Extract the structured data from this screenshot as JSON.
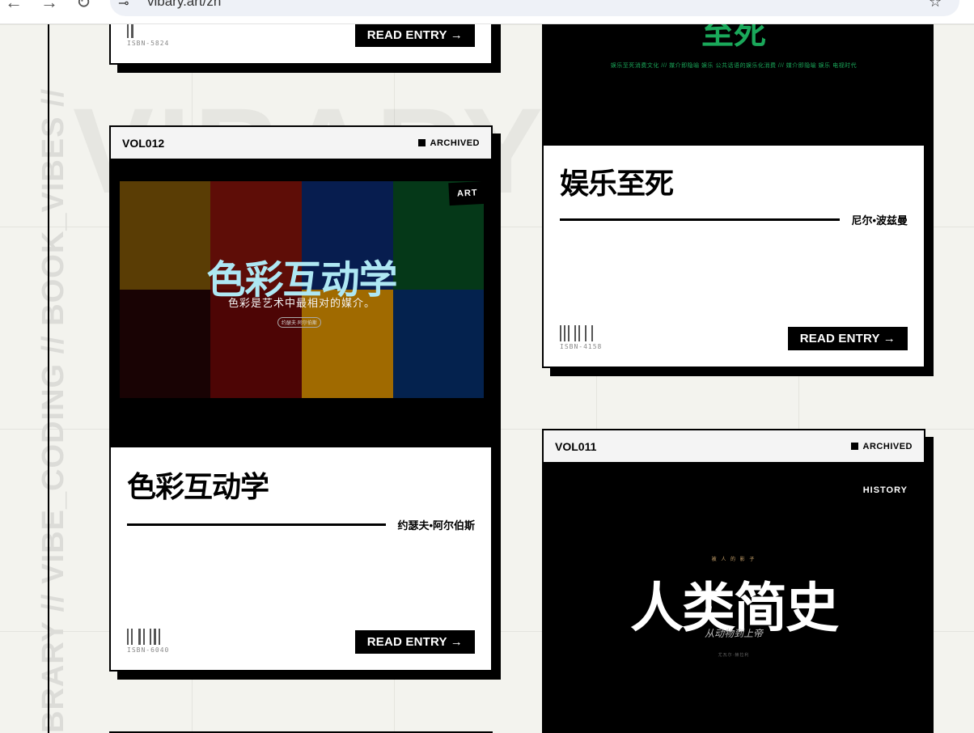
{
  "browser": {
    "url": "vibary.art/zh",
    "back_glyph": "←",
    "forward_glyph": "→",
    "reload_glyph": "↻",
    "site_icon_glyph": "⊸",
    "star_glyph": "☆"
  },
  "background": {
    "watermark": "VIBARY",
    "vertical_text": "BRARY // VIBE_CODING // BOOK_VIBES //"
  },
  "cards": {
    "prev_left": {
      "isbn": "ISBN-5824",
      "read_label": "READ ENTRY →"
    },
    "vol012": {
      "vol": "VOL012",
      "status": "ARCHIVED",
      "tag": "ART",
      "cover_title": "色彩互动学",
      "cover_subtitle": "色彩是艺术中最相对的媒介。",
      "cover_chip": "约瑟夫·阿尔伯斯",
      "title": "色彩互动学",
      "author": "约瑟夫•阿尔伯斯",
      "isbn": "ISBN-6040",
      "read_label": "READ ENTRY →",
      "tile_colors": [
        "#5a3d05",
        "#5e0d07",
        "#071d4f",
        "#053818",
        "#190304",
        "#4d0505",
        "#a06a00",
        "#04224e"
      ]
    },
    "vol_right_top": {
      "cover_title": "至死",
      "cover_line": "娱乐至死消费文化 /// 媒介即隐喻 娱乐 公共话语的娱乐化消费 /// 媒介即隐喻 娱乐 电视时代",
      "title": "娱乐至死",
      "author": "尼尔•波兹曼",
      "isbn": "ISBN-4158",
      "read_label": "READ ENTRY →"
    },
    "vol011": {
      "vol": "VOL011",
      "status": "ARCHIVED",
      "tag": "HISTORY",
      "cover_kicker": "被 人 的 影 子",
      "cover_title": "人类简史",
      "cover_subtitle": "从动物到上帝",
      "cover_footer": "尤瓦尔·赫拉利"
    }
  },
  "colors": {
    "accent_green": "#1aa85a",
    "cover_title_cyan": "#aee7f3",
    "background": "#f3f3ee"
  }
}
